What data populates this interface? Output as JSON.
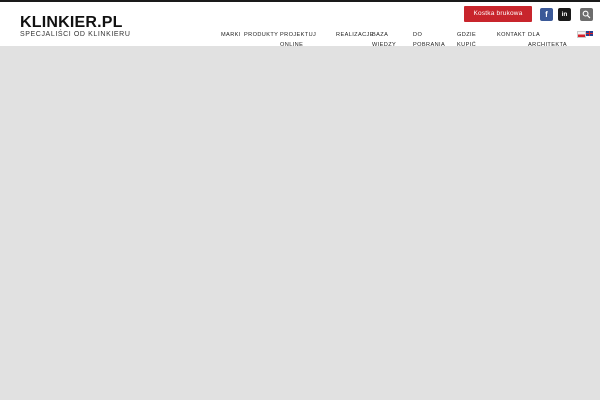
{
  "brand": {
    "logo": "KLINKIER.PL",
    "tagline": "SPECJALIŚCI OD KLINKIERU"
  },
  "header": {
    "cta_label": "Kostka brukowa",
    "social": [
      {
        "icon": "facebook-icon",
        "glyph": "f"
      },
      {
        "icon": "linkedin-icon",
        "glyph": "in"
      }
    ],
    "search_icon": "search-icon"
  },
  "nav": {
    "items": [
      {
        "label": "Marki"
      },
      {
        "label": "Produkty"
      },
      {
        "label": "Projektuj\nonline"
      },
      {
        "label": "Realizacje"
      },
      {
        "label": "Baza\nwiedzy"
      },
      {
        "label": "Do\npobrania"
      },
      {
        "label": "Gdzie\nkupić"
      },
      {
        "label": "Kontakt"
      },
      {
        "label": "Dla\narchitekta"
      }
    ]
  },
  "languages": [
    {
      "code": "pl",
      "icon": "poland-flag-icon"
    },
    {
      "code": "en",
      "icon": "uk-flag-icon"
    }
  ],
  "colors": {
    "accent": "#c8252c",
    "facebook": "#3b5998",
    "content_bg": "#e1e1e1"
  }
}
